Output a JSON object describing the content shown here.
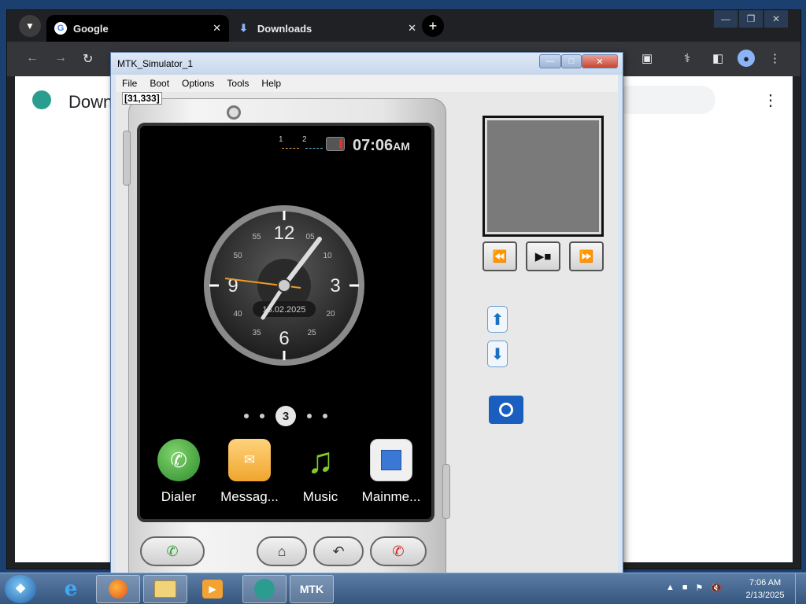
{
  "colors": {
    "chrome_dark": "#202124",
    "window_frame": "#d8e4f2",
    "taskbar": "#35567e",
    "accent_blue": "#1a6fc0"
  },
  "browser": {
    "tabs": [
      {
        "label": "Google",
        "icon": "google-g-icon",
        "active": false
      },
      {
        "label": "Downloads",
        "icon": "download-icon",
        "active": true
      }
    ],
    "content": {
      "title": "Down"
    }
  },
  "simulator": {
    "window_title": "MTK_Simulator_1",
    "menu": [
      "File",
      "Boot",
      "Options",
      "Tools",
      "Help"
    ],
    "coordinate_readout": "[31,333]",
    "status_bar": {
      "sim1_label": "1",
      "sim2_label": "2",
      "time": "07:06",
      "ampm": "AM"
    },
    "clock": {
      "numerals": [
        "12",
        "3",
        "6",
        "9"
      ],
      "minor_numerals": [
        "05",
        "10",
        "20",
        "25",
        "35",
        "40",
        "50",
        "55"
      ],
      "date": "13.02.2025"
    },
    "pager": {
      "current_page": "3"
    },
    "apps": [
      {
        "label": "Dialer",
        "icon": "phone-icon"
      },
      {
        "label": "Messag...",
        "icon": "envelope-icon"
      },
      {
        "label": "Music",
        "icon": "music-note-icon"
      },
      {
        "label": "Mainme...",
        "icon": "main-menu-icon"
      }
    ]
  },
  "taskbar": {
    "clock_time": "7:06 AM",
    "clock_date": "2/13/2025",
    "mtk_label": "MTK"
  }
}
